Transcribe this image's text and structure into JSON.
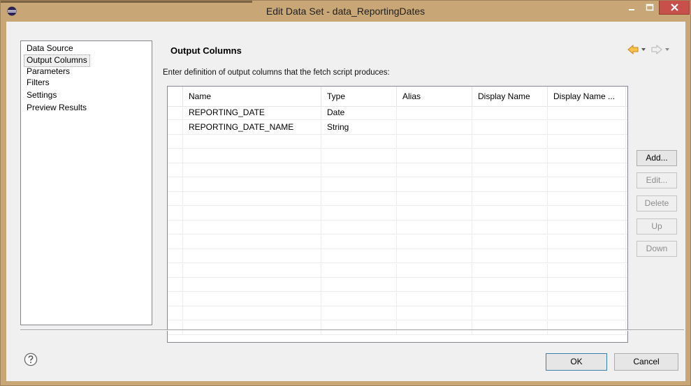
{
  "window": {
    "title": "Edit Data Set - data_ReportingDates"
  },
  "nav": {
    "items": [
      {
        "label": "Data Source"
      },
      {
        "label": "Output Columns"
      },
      {
        "label": "Parameters"
      },
      {
        "label": "Filters"
      },
      {
        "label": "Settings"
      },
      {
        "label": "Preview Results"
      }
    ],
    "selected": "Output Columns"
  },
  "page": {
    "title": "Output Columns",
    "instructions": "Enter definition of output columns that the fetch script produces:"
  },
  "table": {
    "columns": [
      "Name",
      "Type",
      "Alias",
      "Display Name",
      "Display Name ..."
    ],
    "rows": [
      [
        "REPORTING_DATE",
        "Date",
        "",
        "",
        ""
      ],
      [
        "REPORTING_DATE_NAME",
        "String",
        "",
        "",
        ""
      ]
    ]
  },
  "buttons": {
    "add": "Add...",
    "edit": "Edit...",
    "delete": "Delete",
    "up": "Up",
    "down": "Down",
    "ok": "OK",
    "cancel": "Cancel"
  },
  "icons": {
    "app": "eclipse-icon",
    "back": "back-arrow-icon",
    "forward": "forward-arrow-icon",
    "help": "help-icon"
  },
  "colors": {
    "title_bar": "#c9a676",
    "close_button": "#c7504a",
    "back_arrow": "#e6a817"
  }
}
